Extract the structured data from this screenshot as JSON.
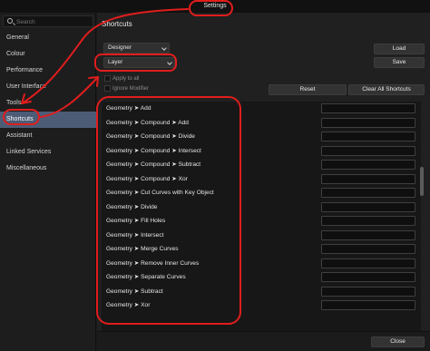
{
  "window": {
    "title": "Settings"
  },
  "sidebar": {
    "search_placeholder": "Search",
    "items": [
      {
        "label": "General"
      },
      {
        "label": "Colour"
      },
      {
        "label": "Performance"
      },
      {
        "label": "User Interface"
      },
      {
        "label": "Tools"
      },
      {
        "label": "Shortcuts"
      },
      {
        "label": "Assistant"
      },
      {
        "label": "Linked Services"
      },
      {
        "label": "Miscellaneous"
      }
    ],
    "active_item": "Shortcuts"
  },
  "main": {
    "heading": "Shortcuts",
    "app_select": "Designer",
    "persona_select": "Layer",
    "apply_to_all": "Apply to all",
    "ignore_modifier": "Ignore Modifier",
    "load_label": "Load",
    "save_label": "Save",
    "reset_label": "Reset",
    "clear_all_label": "Clear All Shortcuts",
    "shortcuts": [
      {
        "label": "Geometry ➤ Add"
      },
      {
        "label": "Geometry ➤ Compound ➤ Add"
      },
      {
        "label": "Geometry ➤ Compound ➤ Divide"
      },
      {
        "label": "Geometry ➤ Compound ➤ Intersect"
      },
      {
        "label": "Geometry ➤ Compound ➤ Subtract"
      },
      {
        "label": "Geometry ➤ Compound ➤ Xor"
      },
      {
        "label": "Geometry ➤ Cut Curves with Key Object"
      },
      {
        "label": "Geometry ➤ Divide"
      },
      {
        "label": "Geometry ➤ Fill Holes"
      },
      {
        "label": "Geometry ➤ Intersect"
      },
      {
        "label": "Geometry ➤ Merge Curves"
      },
      {
        "label": "Geometry ➤ Remove Inner Curves"
      },
      {
        "label": "Geometry ➤ Separate Curves"
      },
      {
        "label": "Geometry ➤ Subtract"
      },
      {
        "label": "Geometry ➤ Xor"
      }
    ],
    "close_label": "Close"
  },
  "annotation_color": "#e01d1d"
}
